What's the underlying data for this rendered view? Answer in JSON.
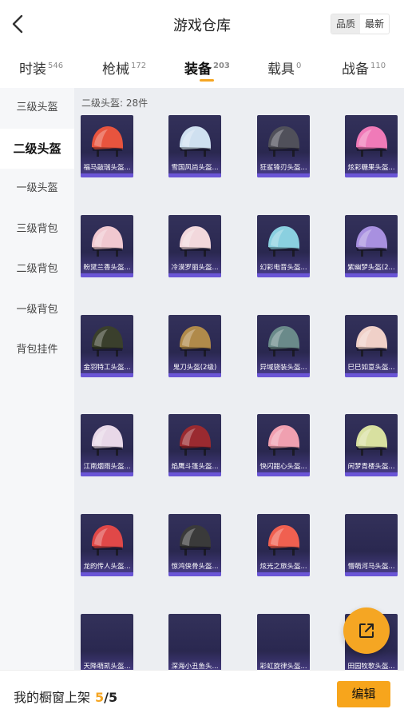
{
  "header": {
    "title": "游戏仓库",
    "sort_options": [
      "品质",
      "最新"
    ],
    "sort_active_index": 0
  },
  "tabs": [
    {
      "label": "时装",
      "count": "546"
    },
    {
      "label": "枪械",
      "count": "172"
    },
    {
      "label": "装备",
      "count": "203",
      "active": true
    },
    {
      "label": "载具",
      "count": "0"
    },
    {
      "label": "战备",
      "count": "110"
    }
  ],
  "sidebar": {
    "items": [
      "三级头盔",
      "二级头盔",
      "一级头盔",
      "三级背包",
      "二级背包",
      "一级背包",
      "背包挂件"
    ],
    "active_index": 1
  },
  "section": {
    "header": "二级头盔: 28件"
  },
  "items": [
    {
      "name": "福马敲瑞头盔...",
      "icon": "helmet-icon",
      "color": "#e8543e"
    },
    {
      "name": "雪国风尚头盔...",
      "icon": "helmet-icon",
      "color": "#cfe0f0"
    },
    {
      "name": "狂鲨锋刃头盔...",
      "icon": "helmet-icon",
      "color": "#50505a"
    },
    {
      "name": "炫彩糖果头盔...",
      "icon": "helmet-icon",
      "color": "#f07ab8"
    },
    {
      "name": "粉黛兰香头盔...",
      "icon": "helmet-icon",
      "color": "#f0c8d0"
    },
    {
      "name": "冷漠罗丽头盔...",
      "icon": "helmet-icon",
      "color": "#f2d8dc"
    },
    {
      "name": "幻彩电音头盔...",
      "icon": "helmet-icon",
      "color": "#8ad0e0"
    },
    {
      "name": "紫幽梦头盔(2...",
      "icon": "helmet-icon",
      "color": "#a890e0"
    },
    {
      "name": "金羽特工头盔...",
      "icon": "helmet-icon",
      "color": "#3a3f2c"
    },
    {
      "name": "鬼刀头盔(2级)",
      "icon": "helmet-icon",
      "color": "#b08a4a"
    },
    {
      "name": "异域骁装头盔...",
      "icon": "helmet-icon",
      "color": "#6a8a8a"
    },
    {
      "name": "巳巳如意头盔...",
      "icon": "helmet-icon",
      "color": "#f0d0c8"
    },
    {
      "name": "江南烟雨头盔...",
      "icon": "helmet-icon",
      "color": "#e8d8e8"
    },
    {
      "name": "焰鹰斗篷头盔...",
      "icon": "helmet-icon",
      "color": "#9a2a30"
    },
    {
      "name": "快闪甜心头盔...",
      "icon": "helmet-icon",
      "color": "#f0a0b0"
    },
    {
      "name": "闲梦青楼头盔...",
      "icon": "helmet-icon",
      "color": "#d8e0a0"
    },
    {
      "name": "龙的传人头盔...",
      "icon": "helmet-icon",
      "color": "#e04848"
    },
    {
      "name": "惊鸿侠骨头盔...",
      "icon": "helmet-icon",
      "color": "#3a3a3a"
    },
    {
      "name": "炫光之旅头盔...",
      "icon": "helmet-icon",
      "color": "#f06050"
    },
    {
      "name": "懵萌河马头盔...",
      "icon": "",
      "color": ""
    },
    {
      "name": "天降萌凯头盔...",
      "icon": "",
      "color": ""
    },
    {
      "name": "深海小丑鱼头...",
      "icon": "",
      "color": ""
    },
    {
      "name": "彩虹旋律头盔...",
      "icon": "",
      "color": ""
    },
    {
      "name": "田园牧歌头盔...",
      "icon": "",
      "color": ""
    }
  ],
  "bottom_bar": {
    "label": "我的橱窗上架",
    "used": "5",
    "total": "/5",
    "edit_label": "编辑"
  }
}
